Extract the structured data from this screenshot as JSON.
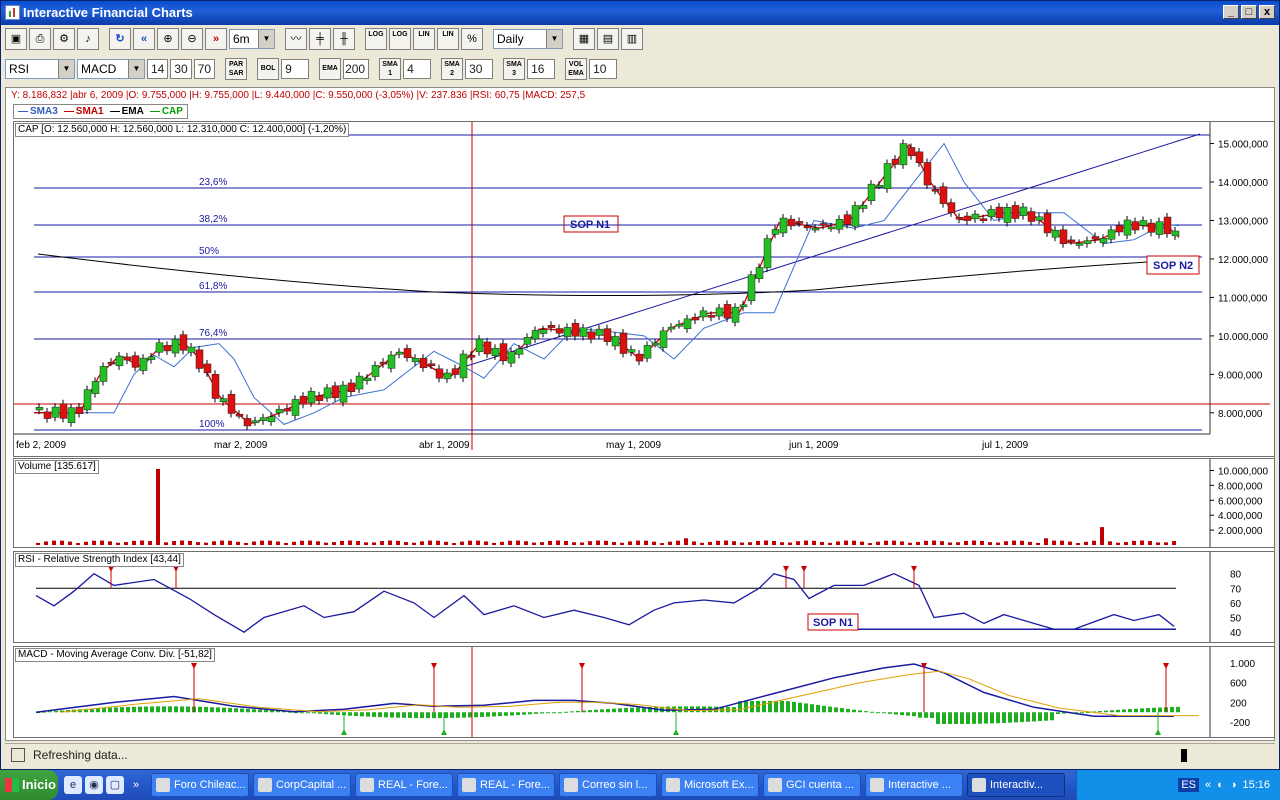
{
  "window": {
    "title": "Interactive Financial Charts",
    "buttons": [
      "_",
      "□",
      "x"
    ]
  },
  "toolbar1": {
    "range_value": "6m",
    "period_value": "Daily",
    "buttons": [
      "LOG",
      "LOG",
      "LIN",
      "LIN",
      "%"
    ]
  },
  "toolbar2": {
    "indicator1": "RSI",
    "indicator2": "MACD",
    "rsi_params": [
      "14",
      "30",
      "70"
    ],
    "parsar_label": "PAR SAR",
    "bol_label": "BOL",
    "bol_value": "9",
    "ema_label": "EMA",
    "ema_value": "200",
    "sma1_label": "SMA 1",
    "sma1_value": "4",
    "sma2_label": "SMA 2",
    "sma2_value": "30",
    "sma3_label": "SMA 3",
    "sma3_value": "16",
    "volema_label": "VOL EMA",
    "volema_value": "10"
  },
  "info_line": "Y: 8.186,832 |abr 6, 2009 |O: 9.755,000 |H: 9.755,000 |L: 9.440,000 |C: 9.550,000 (-3,05%) |V: 237.836 |RSI: 60,75 |MACD: 257,5",
  "legend": [
    {
      "name": "SMA3",
      "color": "#3060c0"
    },
    {
      "name": "SMA1",
      "color": "#c00000"
    },
    {
      "name": "EMA",
      "color": "#000000"
    },
    {
      "name": "CAP",
      "color": "#00a000"
    }
  ],
  "price_panel": {
    "title": "CAP [O: 12.560,000  H: 12.560,000  L: 12.310,000  C: 12.400,000] (-1,20%)",
    "y_ticks": [
      "15.000,000",
      "14.000,000",
      "13.000,000",
      "12.000,000",
      "11.000,000",
      "10.000,000",
      "9.000,000",
      "8.000,000"
    ],
    "x_ticks": [
      "feb 2, 2009",
      "mar 2, 2009",
      "abr 1, 2009",
      "may 1, 2009",
      "jun 1, 2009",
      "jul 1, 2009"
    ],
    "fib_labels": [
      "23,6%",
      "38,2%",
      "50%",
      "61,8%",
      "76,4%",
      "100%"
    ],
    "annotation1": "SOP N1",
    "annotation2": "SOP N2"
  },
  "volume_panel": {
    "title": "Volume [135.617]",
    "y_ticks": [
      "10.000,000",
      "8.000,000",
      "6.000,000",
      "4.000,000",
      "2.000,000"
    ]
  },
  "rsi_panel": {
    "title": "RSI - Relative Strength Index [43,44]",
    "y_ticks": [
      "80",
      "70",
      "60",
      "50",
      "40"
    ],
    "annotation": "SOP N1"
  },
  "macd_panel": {
    "title": "MACD - Moving Average Conv. Div. [-51,82]",
    "y_ticks": [
      "1.000",
      "600",
      "200",
      "-200"
    ]
  },
  "status": {
    "text": "Refreshing data..."
  },
  "taskbar": {
    "start_label": "Inicio",
    "tasks": [
      "Foro Chileac...",
      "CorpCapital ...",
      "REAL - Fore...",
      "REAL - Fore...",
      "Correo sin l...",
      "Microsoft Ex...",
      "GCI cuenta ...",
      "Interactive ...",
      "Interactiv..."
    ],
    "lang": "ES",
    "clock": "15:16"
  },
  "colors": {
    "up_candle": "#22c022",
    "down_candle": "#dd1010",
    "sma3": "#3a70d0",
    "sma1": "#c00000",
    "ema": "#000000",
    "fib": "#1a1aa0"
  }
}
